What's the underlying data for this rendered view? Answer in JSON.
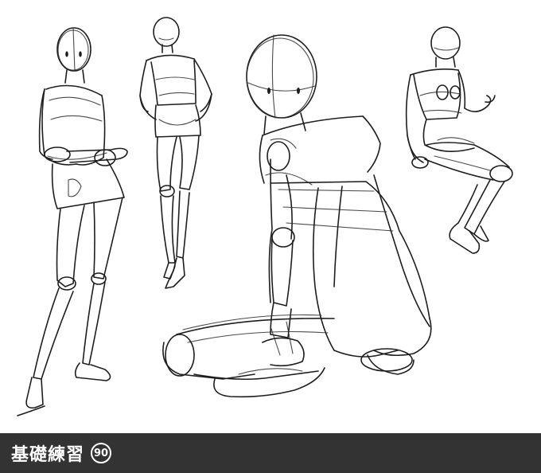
{
  "footer": {
    "title": "基礎練習",
    "number": "90"
  },
  "colors": {
    "footer_background": "#333333",
    "footer_text": "#ffffff",
    "sketch_stroke": "#1e1e1e",
    "canvas_background": "#ffffff"
  }
}
